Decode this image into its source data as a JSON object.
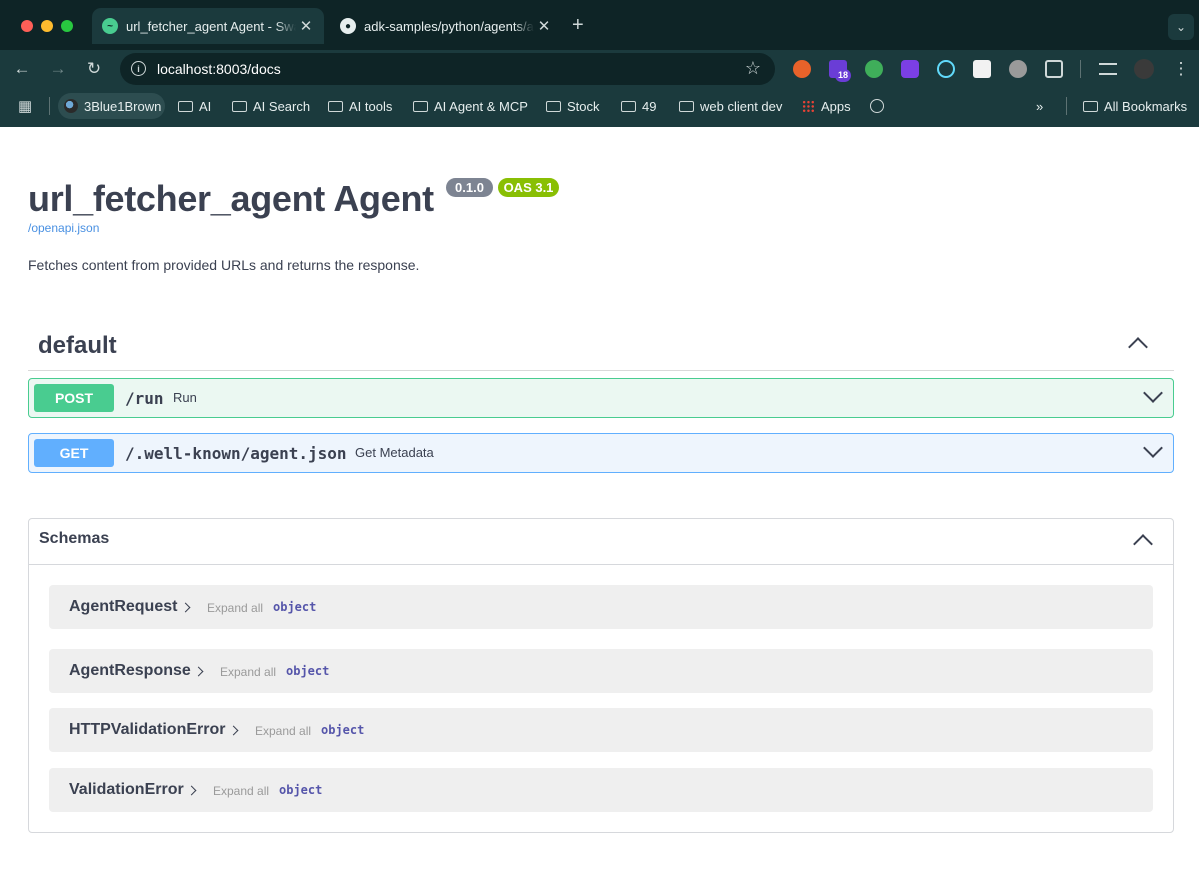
{
  "browser": {
    "tabs": [
      {
        "title": "url_fetcher_agent Agent - Swagger UI",
        "active": true
      },
      {
        "title": "adk-samples/python/agents/a2a",
        "active": false
      }
    ],
    "url": "localhost:8003/docs",
    "extension_badge": "18",
    "bookmarks": [
      "3Blue1Brown",
      "AI",
      "AI Search",
      "AI tools",
      "AI Agent & MCP",
      "Stock",
      "49",
      "web client dev",
      "Apps"
    ],
    "all_bookmarks": "All Bookmarks",
    "overflow": "»"
  },
  "page": {
    "title": "url_fetcher_agent Agent",
    "version": "0.1.0",
    "oas": "OAS 3.1",
    "openapi_link": "/openapi.json",
    "description": "Fetches content from provided URLs and returns the response."
  },
  "section": {
    "name": "default",
    "operations": [
      {
        "method": "POST",
        "path": "/run",
        "summary": "Run"
      },
      {
        "method": "GET",
        "path": "/.well-known/agent.json",
        "summary": "Get Metadata"
      }
    ]
  },
  "schemas": {
    "title": "Schemas",
    "models": [
      {
        "name": "AgentRequest",
        "expand": "Expand all",
        "type": "object"
      },
      {
        "name": "AgentResponse",
        "expand": "Expand all",
        "type": "object"
      },
      {
        "name": "HTTPValidationError",
        "expand": "Expand all",
        "type": "object"
      },
      {
        "name": "ValidationError",
        "expand": "Expand all",
        "type": "object"
      }
    ]
  },
  "colors": {
    "post": "#49cc90",
    "get": "#61affe",
    "oas_badge": "#89bf04",
    "version_badge": "#7d8492"
  }
}
